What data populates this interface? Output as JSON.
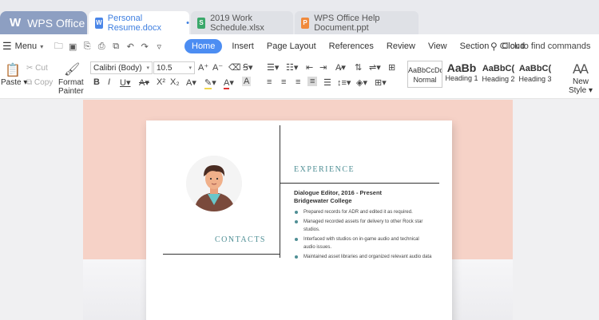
{
  "app": {
    "logo": "W",
    "name": "WPS Office"
  },
  "tabs": [
    {
      "label": "Personal Resume.docx",
      "icon": "writer-doc-icon",
      "modified_marker": "•",
      "active": true
    },
    {
      "label": "2019 Work Schedule.xlsx",
      "icon": "spreadsheet-icon",
      "active": false
    },
    {
      "label": "WPS Office Help Document.ppt",
      "icon": "presentation-icon",
      "active": false
    }
  ],
  "menubar": {
    "menu_label": "Menu",
    "ribbon_tabs": [
      "Home",
      "Insert",
      "Page Layout",
      "References",
      "Review",
      "View",
      "Section",
      "Cloud"
    ],
    "active_tab": "Home",
    "find_placeholder": "Click to find commands"
  },
  "ribbon": {
    "paste_label": "Paste",
    "cut_label": "Cut",
    "copy_label": "Copy",
    "format_painter_label_1": "Format",
    "format_painter_label_2": "Painter",
    "font_family": "Calibri (Body)",
    "font_size": "10.5",
    "styles": [
      {
        "preview": "AaBbCcDd",
        "label": "Normal"
      },
      {
        "preview": "AaBb",
        "label": "Heading 1"
      },
      {
        "preview": "AaBbC(",
        "label": "Heading 2"
      },
      {
        "preview": "AaBbC(",
        "label": "Heading 3"
      }
    ],
    "new_style_label": "New Style"
  },
  "document": {
    "contacts_heading": "CONTACTS",
    "experience_heading": "EXPERIENCE",
    "job_title": "Dialogue Editor, 2016 - Present",
    "company": "Bridgewater College",
    "bullets": [
      "Prepared records for ADR and edited it as required.",
      "Managed recorded assets for delivery to other Rock star",
      "studios.",
      "Interfaced with studios on in-game audio and technical",
      "audio issues.",
      "Maintained asset libraries and organized relevant audio data"
    ]
  },
  "colors": {
    "accent": "#4c8df2",
    "wps_tab": "#8d9fc2",
    "doc_background": "#f6d2c7",
    "heading_teal": "#4f8f95"
  }
}
